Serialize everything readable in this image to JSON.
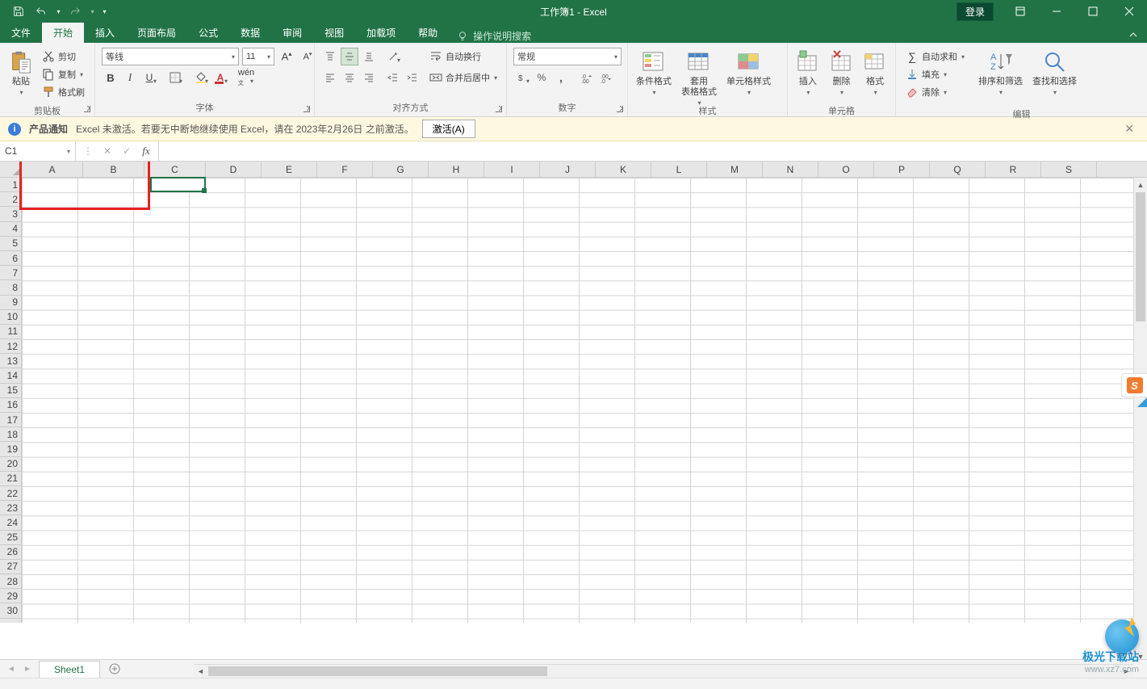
{
  "window": {
    "title": "工作簿1 - Excel",
    "login": "登录"
  },
  "tabs": {
    "file": "文件",
    "home": "开始",
    "insert": "插入",
    "layout": "页面布局",
    "formulas": "公式",
    "data": "数据",
    "review": "审阅",
    "view": "视图",
    "addins": "加载项",
    "help": "帮助",
    "tellme": "操作说明搜索"
  },
  "ribbon": {
    "clipboard": {
      "paste": "粘贴",
      "cut": "剪切",
      "copy": "复制",
      "painter": "格式刷",
      "label": "剪贴板"
    },
    "font": {
      "name": "等线",
      "size": "11",
      "label": "字体"
    },
    "align": {
      "wrap": "自动换行",
      "merge": "合并后居中",
      "label": "对齐方式"
    },
    "number": {
      "format": "常规",
      "label": "数字"
    },
    "styles": {
      "cond": "条件格式",
      "table": "套用\n表格格式",
      "cell": "单元格样式",
      "label": "样式"
    },
    "cells": {
      "insert": "插入",
      "delete": "删除",
      "format": "格式",
      "label": "单元格"
    },
    "editing": {
      "sum": "自动求和",
      "fill": "填充",
      "clear": "清除",
      "sort": "排序和筛选",
      "find": "查找和选择",
      "label": "编辑"
    }
  },
  "warn": {
    "title": "产品通知",
    "msg": "Excel 未激活。若要无中断地继续使用 Excel，请在 2023年2月26日 之前激活。",
    "btn": "激活(A)"
  },
  "namebox": "C1",
  "columns": [
    "A",
    "B",
    "C",
    "D",
    "E",
    "F",
    "G",
    "H",
    "I",
    "J",
    "K",
    "L",
    "M",
    "N",
    "O",
    "P",
    "Q",
    "R",
    "S"
  ],
  "rows": [
    "1",
    "2",
    "3",
    "4",
    "5",
    "6",
    "7",
    "8",
    "9",
    "10",
    "11",
    "12",
    "13",
    "14",
    "15",
    "16",
    "17",
    "18",
    "19",
    "20",
    "21",
    "22",
    "23",
    "24",
    "25",
    "26",
    "27",
    "28",
    "29",
    "30"
  ],
  "sheet": {
    "name": "Sheet1"
  },
  "watermark": {
    "line1": "极光下载站",
    "line2": "www.xz7.com"
  }
}
